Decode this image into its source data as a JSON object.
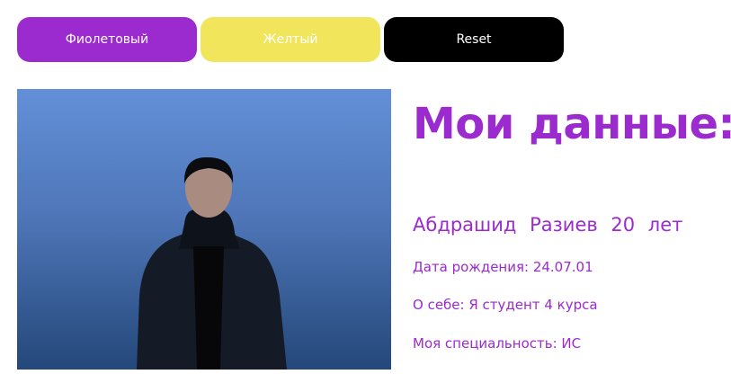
{
  "buttons": {
    "violet": "Фиолетовый",
    "yellow": "Желтый",
    "reset": "Reset"
  },
  "colors": {
    "violet": "#9b2bcf",
    "yellow": "#f1e55c",
    "reset": "#000000"
  },
  "profile": {
    "title": "Мои данные:",
    "name": "Абдрашид  Разиев  20  лет",
    "birth": "Дата рождения: 24.07.01",
    "about": "О себе: Я студент 4 курса",
    "specialty": "Моя специальность: ИС"
  }
}
